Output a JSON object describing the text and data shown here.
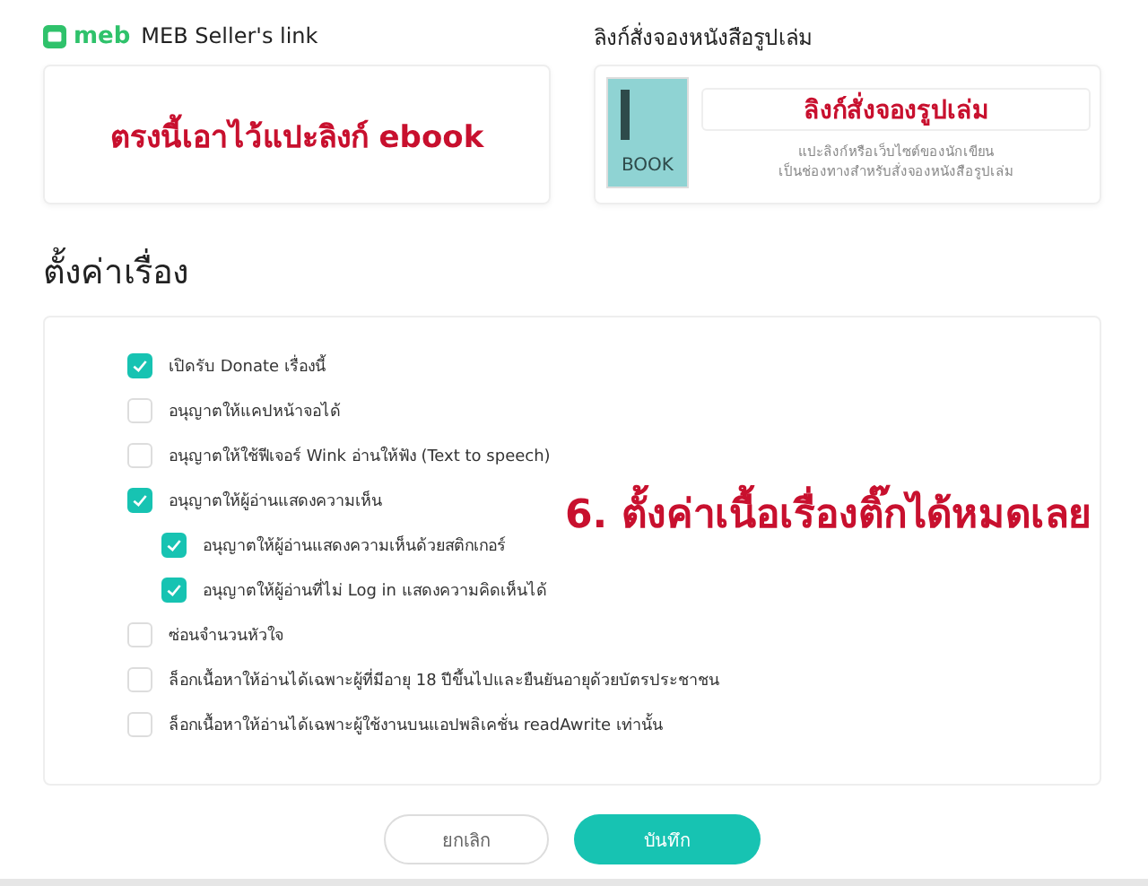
{
  "seller_link": {
    "brand": "meb",
    "title": "MEB Seller's link",
    "annotation": "ตรงนี้เอาไว้แปะลิงก์ ebook"
  },
  "print_link": {
    "title": "ลิงก์สั่งจองหนังสือรูปเล่ม",
    "cover_label": "BOOK",
    "field_value": "ลิงก์สั่งจองรูปเล่ม",
    "hint": "แปะลิงก์หรือเว็บไซต์ของนักเขียน\nเป็นช่องทางสำหรับสั่งจองหนังสือรูปเล่ม"
  },
  "settings": {
    "title": "ตั้งค่าเรื่อง",
    "annotation": "6.  ตั้งค่าเนื้อเรื่องติ๊กได้หมดเลย",
    "options": [
      {
        "label": "เปิดรับ Donate เรื่องนี้",
        "checked": true
      },
      {
        "label": "อนุญาตให้แคปหน้าจอได้",
        "checked": false
      },
      {
        "label": "อนุญาตให้ใช้ฟีเจอร์ Wink อ่านให้ฟัง (Text to speech)",
        "checked": false
      },
      {
        "label": "อนุญาตให้ผู้อ่านแสดงความเห็น",
        "checked": true,
        "children": [
          {
            "label": "อนุญาตให้ผู้อ่านแสดงความเห็นด้วยสติกเกอร์",
            "checked": true
          },
          {
            "label": "อนุญาตให้ผู้อ่านที่ไม่ Log in แสดงความคิดเห็นได้",
            "checked": true
          }
        ]
      },
      {
        "label": "ซ่อนจำนวนหัวใจ",
        "checked": false
      },
      {
        "label": "ล็อกเนื้อหาให้อ่านได้เฉพาะผู้ที่มีอายุ 18 ปีขึ้นไปและยืนยันอายุด้วยบัตรประชาชน",
        "checked": false
      },
      {
        "label": "ล็อกเนื้อหาให้อ่านได้เฉพาะผู้ใช้งานบนแอปพลิเคชั่น readAwrite เท่านั้น",
        "checked": false
      }
    ]
  },
  "buttons": {
    "cancel": "ยกเลิก",
    "save": "บันทึก"
  }
}
